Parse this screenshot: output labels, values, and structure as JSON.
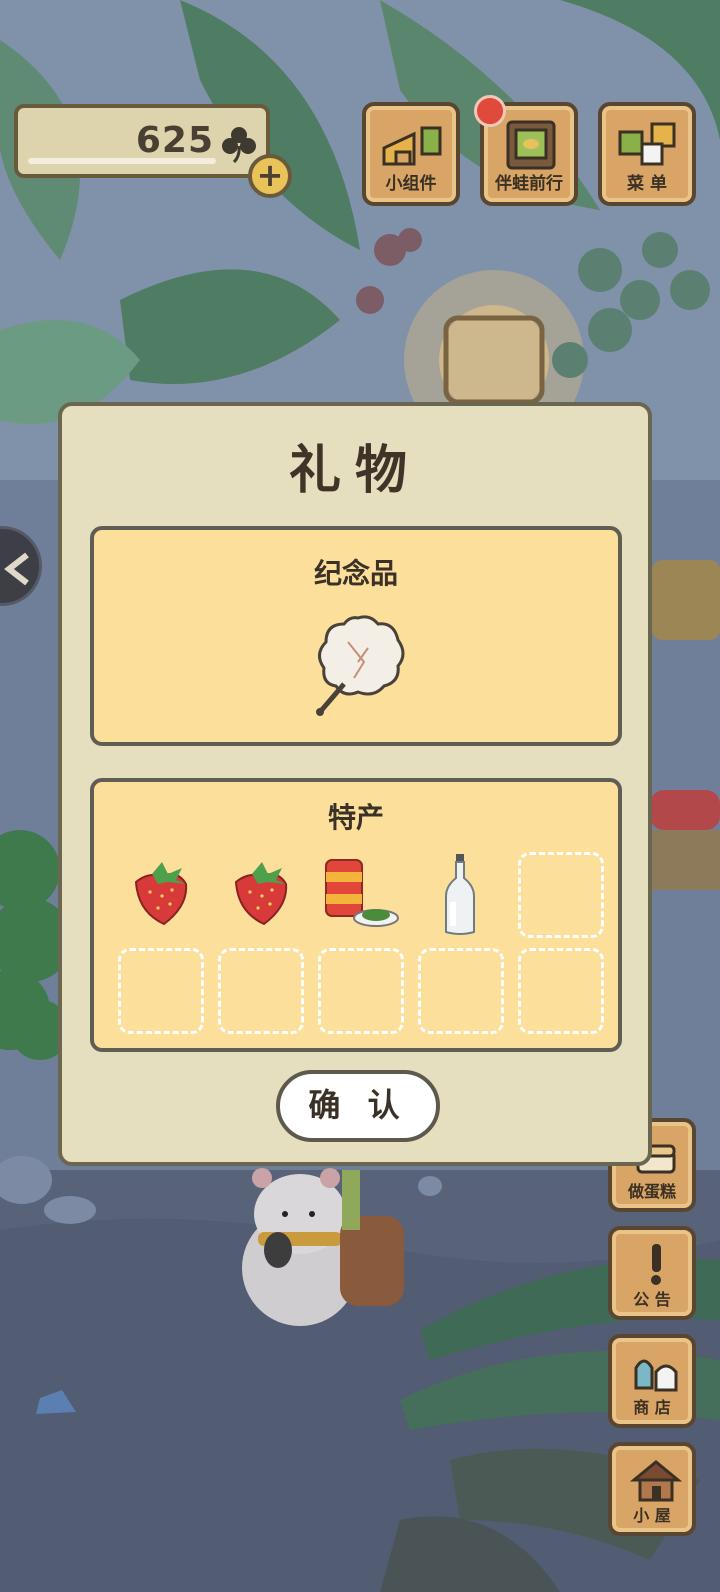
{
  "hud": {
    "clover_count": "625",
    "top_buttons": [
      {
        "label": "小组件"
      },
      {
        "label": "伴蛙前行"
      },
      {
        "label": "菜 单"
      }
    ],
    "side_buttons": [
      {
        "label": "做蛋糕"
      },
      {
        "label": "公 告"
      },
      {
        "label": "商 店"
      },
      {
        "label": "小 屋"
      }
    ]
  },
  "dialog": {
    "title": "礼物",
    "souvenir_panel": {
      "title": "纪念品",
      "item": "fan-icon"
    },
    "specialty_panel": {
      "title": "特产",
      "items": [
        "strawberry-icon",
        "strawberry-icon",
        "canned-food-icon",
        "glass-bottle-icon"
      ],
      "total_slots": 10
    },
    "confirm_label": "确 认"
  },
  "colors": {
    "dialog_bg": "#e6dfbf",
    "panel_bg": "#fddf9c",
    "button_wood": "#d9a566",
    "notification": "#e04a3a"
  }
}
